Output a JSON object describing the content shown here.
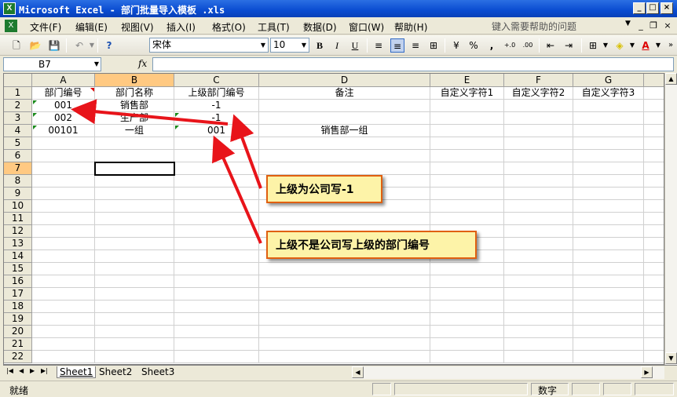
{
  "window": {
    "title": "Microsoft Excel - 部门批量导入模板 .xls"
  },
  "menu": {
    "items": [
      "文件(F)",
      "编辑(E)",
      "视图(V)",
      "插入(I)",
      "格式(O)",
      "工具(T)",
      "数据(D)",
      "窗口(W)",
      "帮助(H)"
    ],
    "help_placeholder": "键入需要帮助的问题"
  },
  "toolbar": {
    "font": "宋体",
    "size": "10",
    "bold": "B",
    "italic": "I",
    "underline": "U",
    "percent": "%",
    "comma": ","
  },
  "formula": {
    "name_box": "B7",
    "fx": "fx",
    "content": ""
  },
  "sheet": {
    "columns": [
      "A",
      "B",
      "C",
      "D",
      "E",
      "F",
      "G"
    ],
    "rows": [
      "1",
      "2",
      "3",
      "4",
      "5",
      "6",
      "7",
      "8",
      "9",
      "10",
      "11",
      "12",
      "13",
      "14",
      "15",
      "16",
      "17",
      "18",
      "19",
      "20",
      "21",
      "22"
    ],
    "cells": [
      [
        "部门编号",
        "部门名称",
        "上级部门编号",
        "备注",
        "自定义字符1",
        "自定义字符2",
        "自定义字符3"
      ],
      [
        "001",
        "销售部",
        "-1",
        "",
        "",
        "",
        ""
      ],
      [
        "002",
        "生产部",
        "-1",
        "",
        "",
        "",
        ""
      ],
      [
        "00101",
        "一组",
        "001",
        "销售部一组",
        "",
        "",
        ""
      ]
    ],
    "selected_cell": "B7"
  },
  "tabs": [
    "Sheet1",
    "Sheet2",
    "Sheet3"
  ],
  "active_tab": "Sheet1",
  "status": {
    "ready": "就绪",
    "mode": "数字"
  },
  "annotations": {
    "callout1": "上级为公司写-1",
    "callout2": "上级不是公司写上级的部门编号"
  },
  "colors": {
    "arrow": "#e8141a",
    "callout_bg": "#fdf3a8",
    "callout_border": "#e06010",
    "titlebar": "#0a4cd1"
  }
}
